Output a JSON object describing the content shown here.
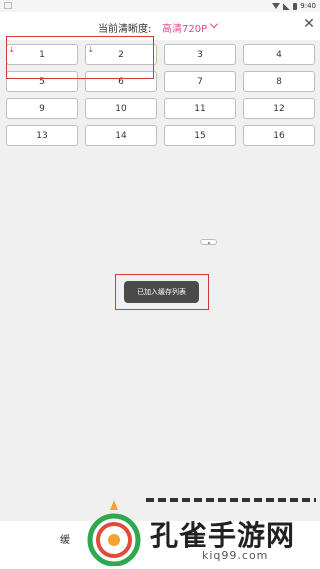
{
  "status_bar": {
    "time": "9:40"
  },
  "header": {
    "label": "当前清晰度:",
    "resolution": "高清720P",
    "close": "✕"
  },
  "episodes": [
    {
      "label": "1",
      "downloaded": true
    },
    {
      "label": "2",
      "downloaded": true
    },
    {
      "label": "3"
    },
    {
      "label": "4"
    },
    {
      "label": "5"
    },
    {
      "label": "6"
    },
    {
      "label": "7"
    },
    {
      "label": "8"
    },
    {
      "label": "9"
    },
    {
      "label": "10"
    },
    {
      "label": "11"
    },
    {
      "label": "12"
    },
    {
      "label": "13"
    },
    {
      "label": "14"
    },
    {
      "label": "15"
    },
    {
      "label": "16"
    }
  ],
  "toast": {
    "message": "已加入缓存列表"
  },
  "bottom_bar": {
    "cache_label": "缓"
  },
  "watermark": {
    "brand": "孔雀手游网",
    "url": "kiq99.com"
  },
  "colors": {
    "accent": "#e2498a",
    "highlight": "#d23a3a"
  }
}
